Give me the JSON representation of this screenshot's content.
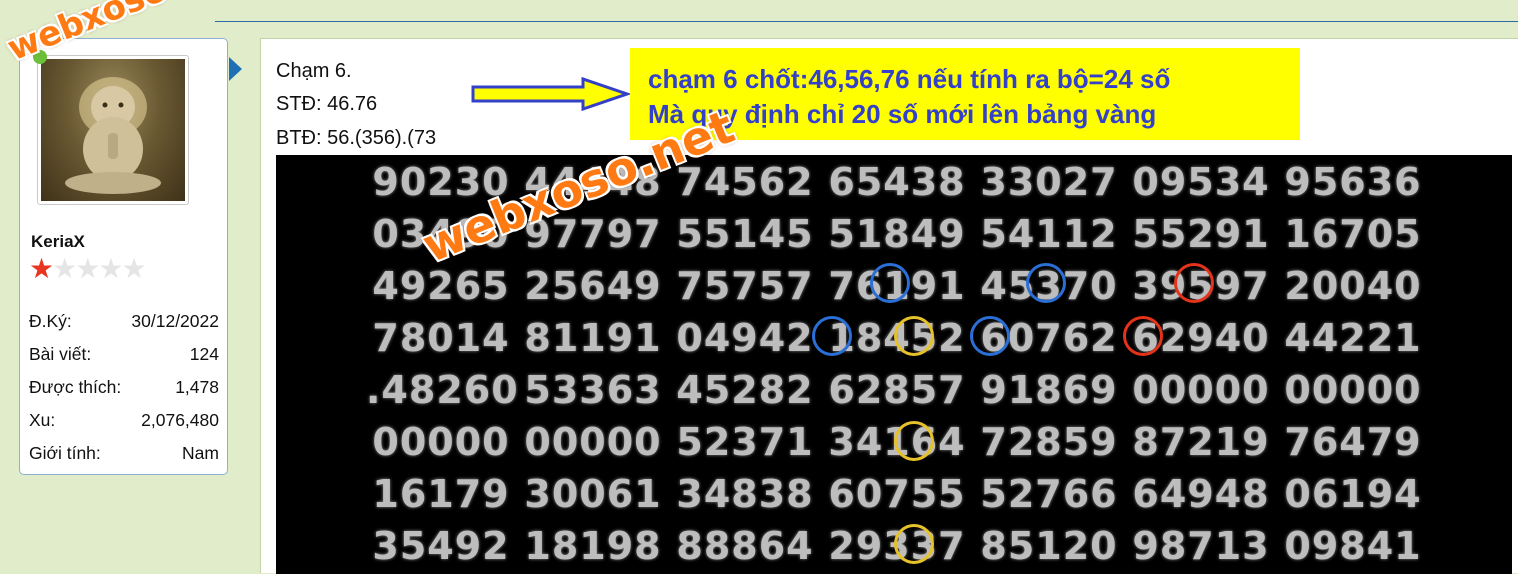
{
  "watermark": "webxoso.net",
  "user": {
    "username": "KeriaX",
    "rating": 1,
    "rating_max": 5,
    "stats": [
      {
        "label": "Đ.Ký:",
        "value": "30/12/2022"
      },
      {
        "label": "Bài viết:",
        "value": "124"
      },
      {
        "label": "Được thích:",
        "value": "1,478"
      },
      {
        "label": "Xu:",
        "value": "2,076,480"
      },
      {
        "label": "Giới tính:",
        "value": "Nam"
      }
    ]
  },
  "post": {
    "lines": [
      "Chạm 6.",
      "STĐ: 46.76",
      "BTĐ: 56.(356).(73"
    ],
    "note": [
      "chạm 6 chốt:46,56,76 nếu tính ra bộ=24 số",
      "Mà quy định chỉ 20 số mới lên bảng vàng"
    ]
  },
  "lottery": {
    "rows": [
      [
        "90230",
        "44448",
        "74562",
        "65438",
        "33027",
        "09534",
        "95636"
      ],
      [
        "03490",
        "97797",
        "55145",
        "51849",
        "54112",
        "55291",
        "16705"
      ],
      [
        "49265",
        "25649",
        "75757",
        "76191",
        "45370",
        "39597",
        "20040"
      ],
      [
        "78014",
        "81191",
        "04942",
        "18452",
        "60762",
        "62940",
        "44221"
      ],
      [
        ".48260",
        "53363",
        "45282",
        "62857",
        "91869",
        "00000",
        "00000"
      ],
      [
        "00000",
        "00000",
        "52371",
        "34164",
        "72859",
        "87219",
        "76479"
      ],
      [
        "16179",
        "30061",
        "34838",
        "60755",
        "52766",
        "64948",
        "06194"
      ],
      [
        "35492",
        "18198",
        "88864",
        "29337",
        "85120",
        "98713",
        "09841"
      ]
    ]
  },
  "colors": {
    "background": "#e1eccb",
    "note_bg": "#ffff00",
    "note_text": "#3340c9",
    "circle_blue": "#2a6fd6",
    "circle_yellow": "#e7c12a",
    "circle_red": "#e5321b",
    "watermark": "#ff7a12"
  }
}
